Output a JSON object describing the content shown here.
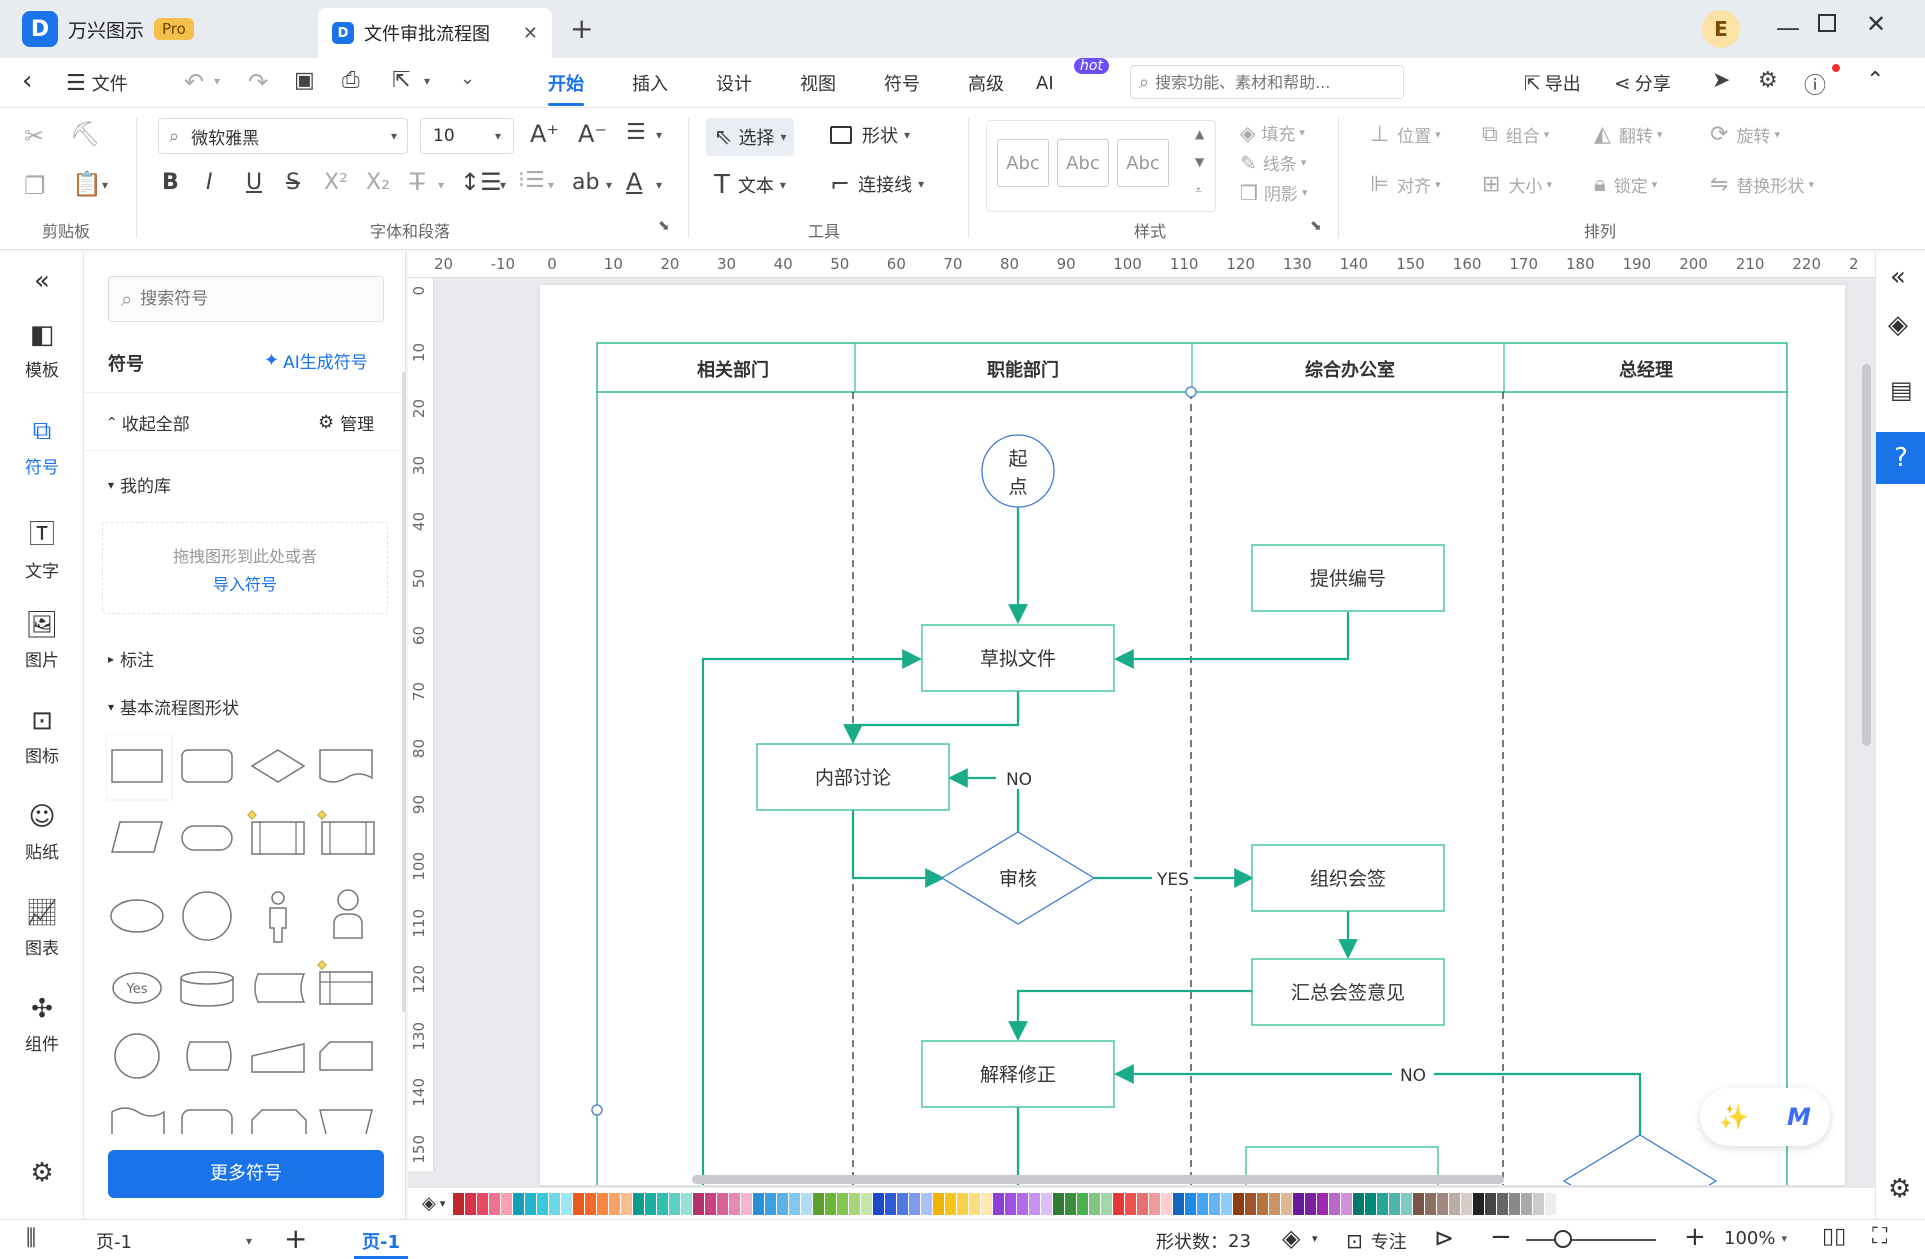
{
  "app": {
    "name": "万兴图示",
    "badge": "Pro",
    "doc_tab": "文件审批流程图",
    "user_initial": "E"
  },
  "menu": {
    "file": "文件",
    "tabs": [
      "开始",
      "插入",
      "设计",
      "视图",
      "符号",
      "高级",
      "AI"
    ],
    "ai_badge": "hot",
    "search_placeholder": "搜索功能、素材和帮助...",
    "export": "导出",
    "share": "分享"
  },
  "ribbon": {
    "groups": {
      "clipboard": "剪贴板",
      "font": "字体和段落",
      "tools": "工具",
      "styles": "样式",
      "arrange": "排列"
    },
    "font_name": "微软雅黑",
    "font_size": "10",
    "select": "选择",
    "shape": "形状",
    "text": "文本",
    "connector": "连接线",
    "style_sample": "Abc",
    "fill": "填充",
    "line": "线条",
    "shadow": "阴影",
    "position": "位置",
    "group": "组合",
    "flip": "翻转",
    "rotate": "旋转",
    "align": "对齐",
    "size": "大小",
    "lock": "锁定",
    "replace": "替换形状"
  },
  "rail": [
    "模板",
    "符号",
    "文字",
    "图片",
    "图标",
    "贴纸",
    "图表",
    "组件"
  ],
  "library": {
    "search_placeholder": "搜索符号",
    "title": "符号",
    "ai_generate": "AI生成符号",
    "collapse_all": "收起全部",
    "manage": "管理",
    "my_library": "我的库",
    "drop_hint": "拖拽图形到此处或者",
    "import_link": "导入符号",
    "annotations": "标注",
    "basic_flow": "基本流程图形状",
    "yes_shape": "Yes",
    "more": "更多符号"
  },
  "ruler": {
    "top": [
      "20",
      "-10",
      "0",
      "10",
      "20",
      "30",
      "40",
      "50",
      "60",
      "70",
      "80",
      "90",
      "100",
      "110",
      "120",
      "130",
      "140",
      "150",
      "160",
      "170",
      "180",
      "190",
      "200",
      "210",
      "220",
      "2"
    ],
    "left": [
      "0",
      "10",
      "20",
      "30",
      "40",
      "50",
      "60",
      "70",
      "80",
      "90",
      "100",
      "110",
      "120",
      "130",
      "140",
      "150"
    ]
  },
  "diagram": {
    "lanes": [
      "相关部门",
      "职能部门",
      "综合办公室",
      "总经理"
    ],
    "nodes": {
      "start_1": "起",
      "start_2": "点",
      "provide": "提供编号",
      "draft": "草拟文件",
      "discuss": "内部讨论",
      "review": "审核",
      "countersign": "组织会签",
      "summary": "汇总会签意见",
      "revise": "解释修正"
    },
    "labels": {
      "no1": "NO",
      "yes": "YES",
      "no2": "NO"
    },
    "colors": {
      "line": "#1aab8a",
      "frame": "#2fbd8f",
      "text": "#333333"
    }
  },
  "status": {
    "page_sel": "页-1",
    "page_tab": "页-1",
    "shape_count_label": "形状数：",
    "shape_count": "23",
    "focus": "专注",
    "zoom": "100%"
  }
}
